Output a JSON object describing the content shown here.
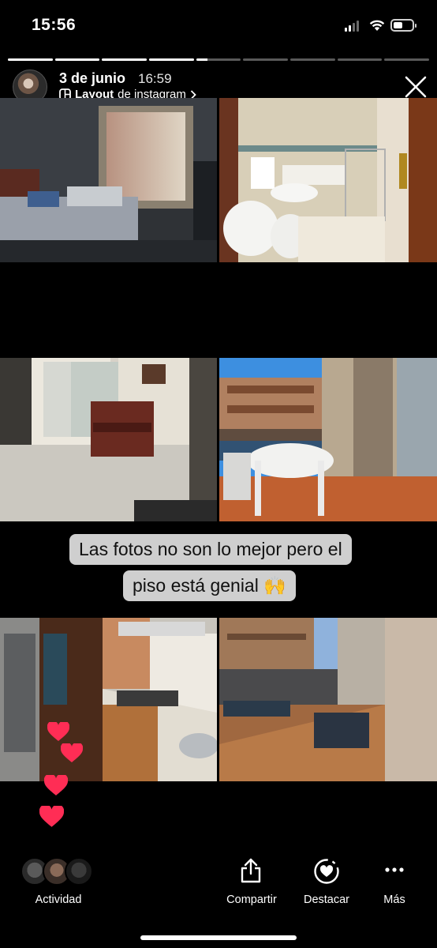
{
  "status_bar": {
    "time": "15:56"
  },
  "story": {
    "segments_total": 9,
    "segments_done": 4,
    "current_segment_fraction": 0.25
  },
  "header": {
    "date": "3 de junio",
    "time": "16:59",
    "layout_bold": "Layout",
    "layout_rest": "de instagram"
  },
  "captions": {
    "line1": "Las fotos no son lo mejor pero el",
    "line2": "piso está genial 🙌"
  },
  "bottom_bar": {
    "activity_label": "Actividad",
    "share_label": "Compartir",
    "highlight_label": "Destacar",
    "more_label": "Más"
  },
  "colors": {
    "heart": "#ff2d55",
    "caption_bg": "#cfcfcf"
  },
  "icons": [
    "close-icon",
    "share-icon",
    "highlight-heart-icon",
    "more-dots-icon",
    "layout-icon",
    "chevron-right-icon"
  ]
}
